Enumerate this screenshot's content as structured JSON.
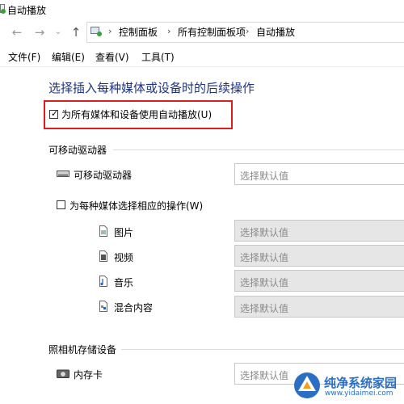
{
  "window": {
    "title": "自动播放"
  },
  "address": {
    "breadcrumbs": [
      "控制面板",
      "所有控制面板项",
      "自动播放"
    ]
  },
  "menu": [
    "文件(F)",
    "编辑(E)",
    "查看(V)",
    "工具(T)"
  ],
  "page_title": "选择插入每种媒体或设备时的后续操作",
  "use_autoplay": {
    "label": "为所有媒体和设备使用自动播放(U)",
    "checked": true
  },
  "removable": {
    "section_label": "可移动驱动器",
    "drive_label": "可移动驱动器",
    "drive_select": "选择默认值",
    "per_media": {
      "label": "为每种媒体选择相应的操作(W)",
      "checked": false
    },
    "media": [
      {
        "label": "图片",
        "icon": "picture-file-icon",
        "select": "选择默认值"
      },
      {
        "label": "视频",
        "icon": "video-file-icon",
        "select": "选择默认值"
      },
      {
        "label": "音乐",
        "icon": "music-file-icon",
        "select": "选择默认值"
      },
      {
        "label": "混合内容",
        "icon": "mixed-content-file-icon",
        "select": "选择默认值"
      }
    ]
  },
  "camera": {
    "section_label": "照相机存储设备",
    "card_label": "内存卡",
    "card_select": "选择默认值"
  },
  "watermark": {
    "title": "纯净系统家园",
    "url": "www.yidaimei.com"
  },
  "colors": {
    "heading": "#1e3287",
    "highlight": "#e11c1c",
    "watermark": "#2a6fc4"
  }
}
